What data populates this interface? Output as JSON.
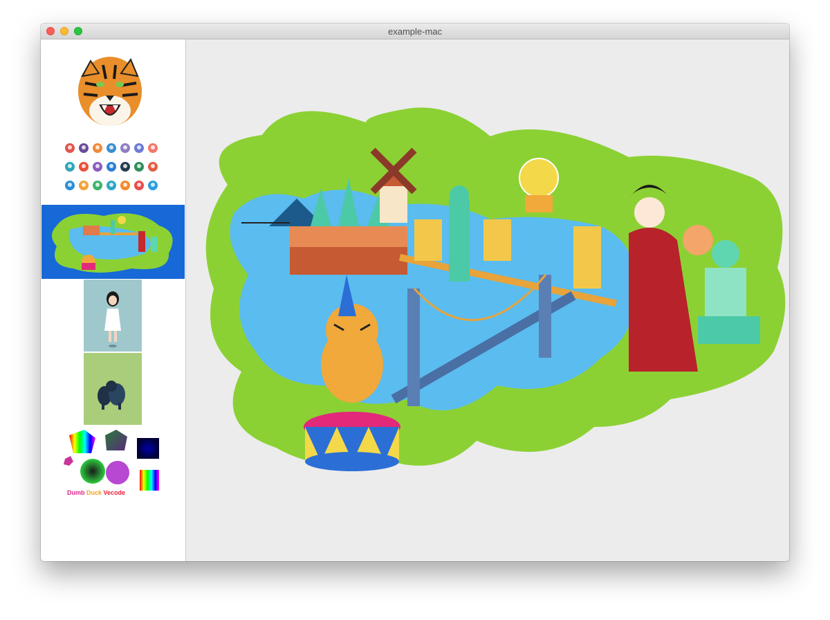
{
  "window": {
    "title": "example-mac"
  },
  "sidebar": {
    "items": [
      {
        "name": "Tiger head"
      },
      {
        "name": "Flat avatar icons"
      },
      {
        "name": "Travel map scene",
        "selected": true
      },
      {
        "name": "Girl figure"
      },
      {
        "name": "Dark animals"
      },
      {
        "name": "Shapes and gradients"
      }
    ],
    "brand": {
      "word1": "Dumb",
      "word2": "Duck",
      "word3": "Vecode",
      "color1": "#e4238a",
      "color2": "#f3a21a",
      "color3": "#e81f3a"
    }
  },
  "colors": {
    "selected": "#1669d6",
    "land": "#8cd134",
    "water": "#5bbcef",
    "canvas": "#ececec"
  }
}
